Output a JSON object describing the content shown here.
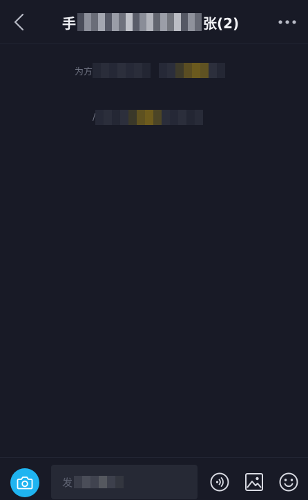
{
  "header": {
    "title_start": "手",
    "title_end": "张(2)",
    "back_icon": "chevron-left-icon",
    "more_icon": "more-horizontal-icon"
  },
  "messages": [
    {
      "prefix": "为方"
    },
    {
      "prefix": "/"
    }
  ],
  "composer": {
    "input_placeholder": "发",
    "camera_icon": "camera-icon",
    "voice_icon": "voice-icon",
    "image_icon": "image-icon",
    "emoji_icon": "emoji-icon"
  },
  "colors": {
    "background": "#181a26",
    "accent": "#1fb4f0",
    "title_text": "#f2f3f7",
    "muted_text": "#6f7382",
    "input_bg": "#262935"
  }
}
